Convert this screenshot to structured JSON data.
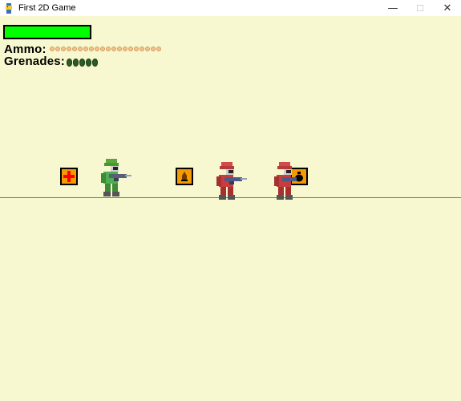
{
  "window": {
    "title": "First 2D Game",
    "controls": {
      "minimize": "—",
      "maximize": "☐",
      "close": "✕"
    }
  },
  "hud": {
    "health_fraction": 1.0,
    "ammo_label": "Ammo:",
    "ammo_count": 20,
    "grenades_label": "Grenades:",
    "grenade_count": 5
  },
  "colors": {
    "background": "#f8f8d0",
    "health": "#00ff00",
    "ground_line": "#ff3b2a",
    "crate": "#f59a00",
    "player": "#4caf50",
    "enemy": "#c83c3c"
  },
  "entities": {
    "crates": [
      {
        "kind": "health",
        "icon": "red-cross-icon"
      },
      {
        "kind": "ammo",
        "icon": "bullet-icon"
      },
      {
        "kind": "grenade",
        "icon": "grenade-icon"
      }
    ],
    "player": {
      "team": "green",
      "facing": "right"
    },
    "enemies": [
      {
        "team": "red",
        "facing": "right"
      },
      {
        "team": "red",
        "facing": "right"
      }
    ]
  }
}
